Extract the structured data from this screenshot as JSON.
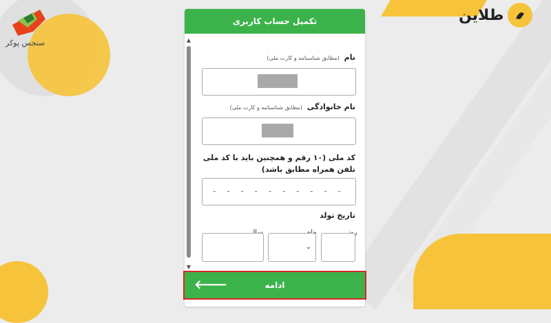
{
  "brand_left": {
    "name": "سنجس پوکر"
  },
  "brand_right": {
    "name": "طلاین"
  },
  "form": {
    "title": "تکمیل حساب کاربری",
    "first_name_label": "نام",
    "first_name_hint": "(مطابق شناسنامه و کارت ملی)",
    "last_name_label": "نام خانوادگی",
    "last_name_hint": "(مطابق شناسنامه و کارت ملی)",
    "national_code_label": "کد ملی (۱۰ رقم و همچنین باید با کد ملی تلفن همراه مطابق باشد)",
    "national_code_placeholder": "- - - - - - - - - -",
    "birth_date_label": "تاریخ تولد",
    "day_label": "روز",
    "month_label": "ماه",
    "year_label": "سال",
    "continue_label": "ادامه"
  },
  "colors": {
    "accent_green": "#3cb34a",
    "brand_yellow": "#f6c33a",
    "highlight_red": "#d9262c"
  },
  "icons": {
    "continue": "arrow-left-icon",
    "select": "chevron-down-icon",
    "scroll_up": "triangle-up-icon",
    "scroll_down": "triangle-down-icon"
  }
}
